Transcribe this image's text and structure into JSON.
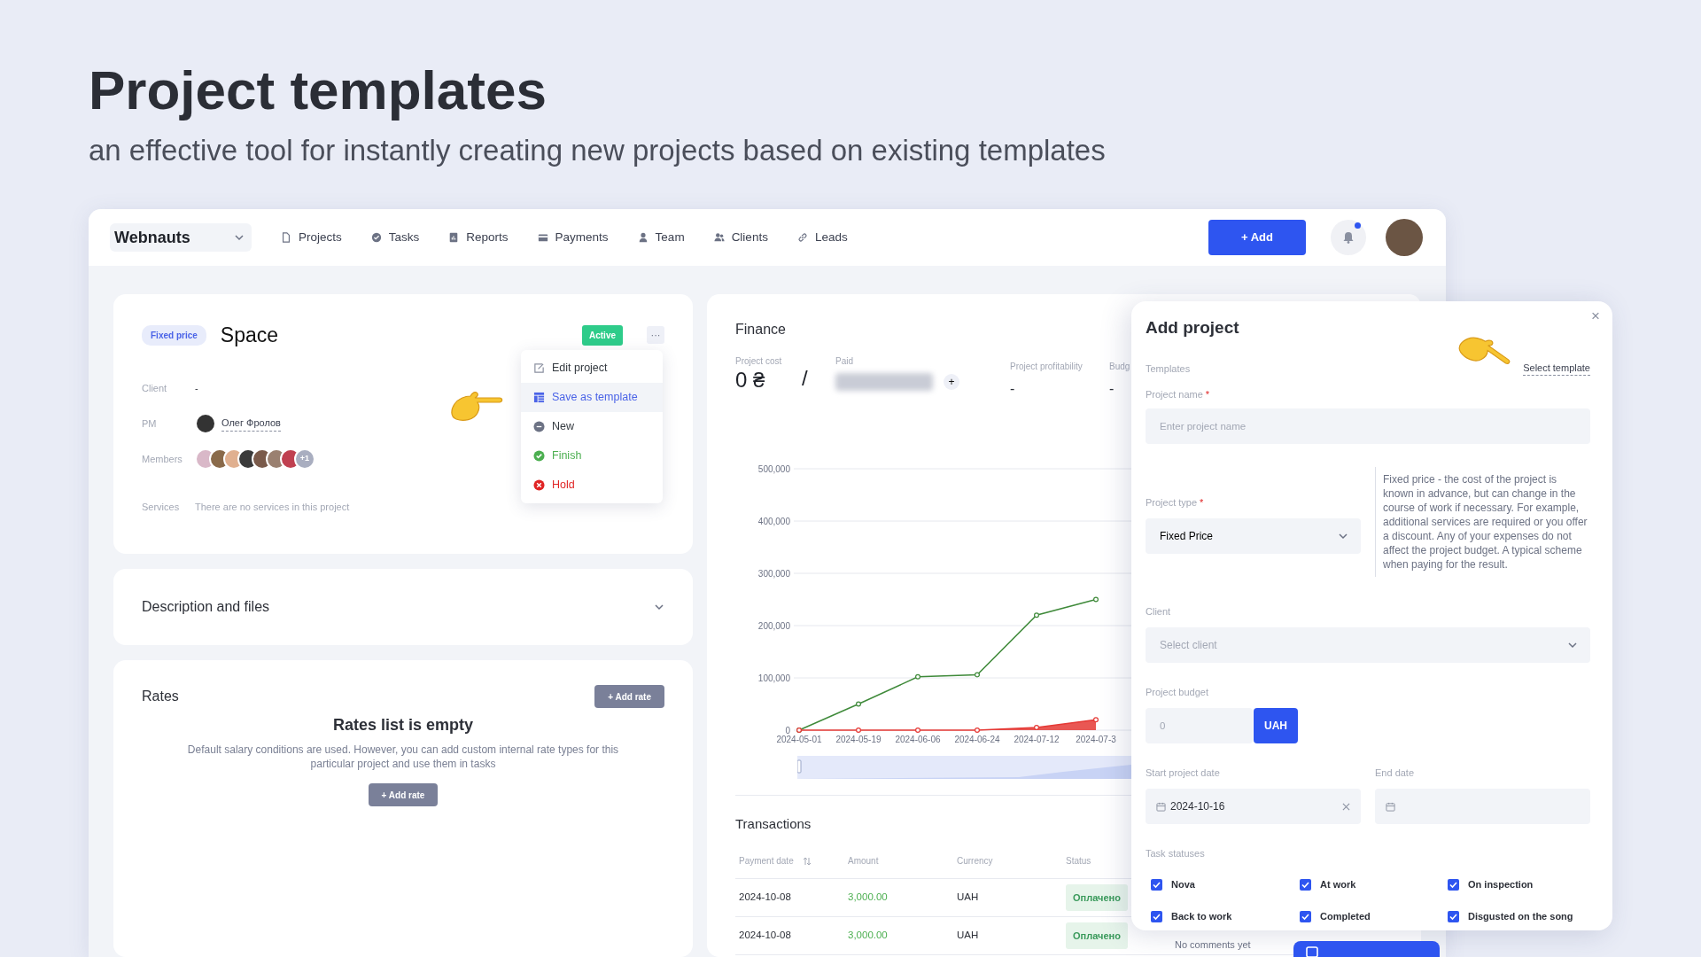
{
  "page": {
    "title": "Project templates",
    "subtitle": "an effective tool for instantly creating new projects based on existing templates"
  },
  "navbar": {
    "workspace": "Webnauts",
    "items": [
      {
        "label": "Projects",
        "kind": "document"
      },
      {
        "label": "Tasks",
        "kind": "check"
      },
      {
        "label": "Reports",
        "kind": "report"
      },
      {
        "label": "Payments",
        "kind": "card"
      },
      {
        "label": "Team",
        "kind": "person"
      },
      {
        "label": "Clients",
        "kind": "people"
      },
      {
        "label": "Leads",
        "kind": "link"
      }
    ],
    "add_button": "+ Add",
    "notifications": {
      "unread": true
    }
  },
  "project_card": {
    "type_badge": "Fixed price",
    "title": "Space",
    "status_badge": "Active",
    "menu_button": "···",
    "menu": [
      {
        "label": "Edit project",
        "kind": "edit",
        "selected": false,
        "color": "#343a40"
      },
      {
        "label": "Save as template",
        "kind": "template",
        "selected": true,
        "color": "#4a63e7"
      },
      {
        "label": "New",
        "kind": "new",
        "selected": false,
        "color": "#343a40"
      },
      {
        "label": "Finish",
        "kind": "finish",
        "selected": false,
        "color": "#4caf50"
      },
      {
        "label": "Hold",
        "kind": "hold",
        "selected": false,
        "color": "#e02424"
      }
    ],
    "client": {
      "label": "Client",
      "value": "-"
    },
    "pm": {
      "label": "PM",
      "name": "Олег Фролов"
    },
    "members": {
      "label": "Members",
      "avatars": [
        {
          "color": "#d9b8c8"
        },
        {
          "color": "#8a6a4a"
        },
        {
          "color": "#e0b090"
        },
        {
          "color": "#3a3a3a"
        },
        {
          "color": "#7a5a4a"
        },
        {
          "color": "#9a8070"
        },
        {
          "color": "#c04050"
        }
      ],
      "more": "+1"
    },
    "services": {
      "label": "Services",
      "value": "There are no services in this project"
    }
  },
  "description_card": {
    "title": "Description and files",
    "expanded": false
  },
  "rates": {
    "title": "Rates",
    "add_button": "+ Add rate",
    "empty_title": "Rates list is empty",
    "empty_text": "Default salary conditions are used. However, you can add custom internal rate types for this particular project and use them in tasks",
    "empty_button": "+ Add rate"
  },
  "finance": {
    "title": "Finance",
    "cost": {
      "label": "Project cost",
      "value": "0 ₴"
    },
    "separator": "/",
    "paid": {
      "label": "Paid",
      "add_button": "+"
    },
    "metrics": [
      {
        "label": "Project profitability",
        "value": "-"
      },
      {
        "label": "Budg",
        "value": "-"
      }
    ],
    "chart_data": {
      "type": "line",
      "categories": [
        "2024-05-01",
        "2024-05-19",
        "2024-06-06",
        "2024-06-24",
        "2024-07-12",
        "2024-07-3"
      ],
      "ylim": [
        0,
        500000
      ],
      "yticks": [
        {
          "value": 0,
          "label": "0"
        },
        {
          "value": 100000,
          "label": "100,000"
        },
        {
          "value": 200000,
          "label": "200,000"
        },
        {
          "value": 300000,
          "label": "300,000"
        },
        {
          "value": 400000,
          "label": "400,000"
        },
        {
          "value": 500000,
          "label": "500,000"
        }
      ],
      "grid": true,
      "series": [
        {
          "marker": "circle",
          "color": "#3f8a3a",
          "values": [
            0,
            50000,
            102000,
            106000,
            220000,
            250000
          ]
        },
        {
          "type": "area",
          "marker": "circle",
          "color": "#e53935",
          "values": [
            0,
            0,
            0,
            0,
            5000,
            20000
          ]
        }
      ]
    }
  },
  "transactions": {
    "title": "Transactions",
    "columns": [
      {
        "label": "Payment date",
        "sortable": true
      },
      {
        "label": "Amount",
        "sortable": false
      },
      {
        "label": "Currency",
        "sortable": false
      },
      {
        "label": "Status",
        "sortable": false
      }
    ],
    "rows": [
      {
        "date": "2024-10-08",
        "amount": "3,000.00",
        "currency": "UAH",
        "status": "Оплачено"
      },
      {
        "date": "2024-10-08",
        "amount": "3,000.00",
        "currency": "UAH",
        "status": "Оплачено",
        "column_5": "No comments yet"
      }
    ]
  },
  "add_project": {
    "title": "Add project",
    "close": "×",
    "templates_label": "Templates",
    "select_template": "Select template",
    "name": {
      "label": "Project name",
      "required_mark": "*",
      "placeholder": "Enter project name"
    },
    "type": {
      "label": "Project type",
      "required_mark": "*",
      "value": "Fixed Price",
      "help": "Fixed price - the cost of the project is known in advance, but can change in the course of work if necessary. For example, additional services are required or you offer a discount. Any of your expenses do not affect the project budget. A typical scheme when paying for the result."
    },
    "client": {
      "label": "Client",
      "placeholder": "Select client"
    },
    "budget": {
      "label": "Project budget",
      "placeholder": "0",
      "currency": "UAH"
    },
    "start_date": {
      "label": "Start project date",
      "value": "2024-10-16"
    },
    "end_date": {
      "label": "End date"
    },
    "statuses_label": "Task statuses",
    "statuses": [
      {
        "label": "Nova",
        "checked": true
      },
      {
        "label": "At work",
        "checked": true
      },
      {
        "label": "On inspection",
        "checked": true
      },
      {
        "label": "Back to work",
        "checked": true
      },
      {
        "label": "Completed",
        "checked": true
      },
      {
        "label": "Disgusted on the song",
        "checked": true
      }
    ]
  }
}
